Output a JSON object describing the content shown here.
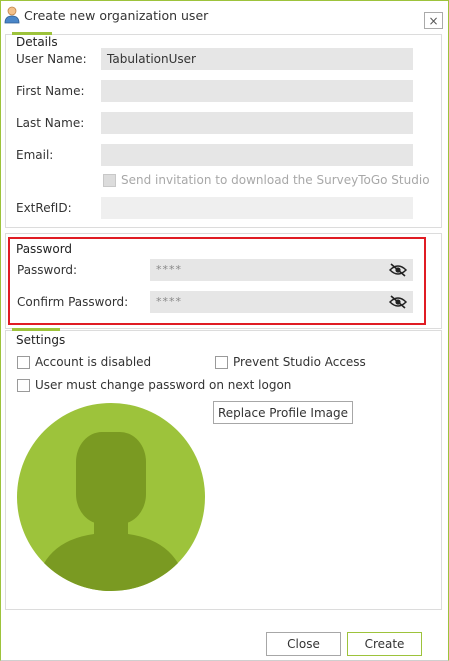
{
  "window": {
    "title": "Create new organization user",
    "close_glyph": "×"
  },
  "details": {
    "title": "Details",
    "user_name_label": "User Name:",
    "user_name_value": "TabulationUser",
    "first_name_label": "First Name:",
    "first_name_value": "",
    "last_name_label": "Last Name:",
    "last_name_value": "",
    "email_label": "Email:",
    "email_value": "",
    "send_invitation_label": "Send invitation to download the SurveyToGo Studio",
    "send_invitation_checked": false,
    "ext_ref_label": "ExtRefID:",
    "ext_ref_value": ""
  },
  "password": {
    "title": "Password",
    "password_label": "Password:",
    "password_mask": "****",
    "confirm_label": "Confirm Password:",
    "confirm_mask": "****",
    "toggle_icon": "eye-slash-icon"
  },
  "settings": {
    "title": "Settings",
    "account_disabled_label": "Account is disabled",
    "account_disabled_checked": false,
    "prevent_studio_label": "Prevent Studio Access",
    "prevent_studio_checked": false,
    "must_change_label": "User must change password on next logon",
    "must_change_checked": false,
    "replace_image_label": "Replace Profile Image",
    "avatar_icon": "user-silhouette-icon"
  },
  "footer": {
    "close_label": "Close",
    "create_label": "Create"
  },
  "colors": {
    "accent": "#9dc33b",
    "avatar_bg": "#9dc33b",
    "avatar_fg": "#7a9a22",
    "highlight": "#e01c24"
  }
}
